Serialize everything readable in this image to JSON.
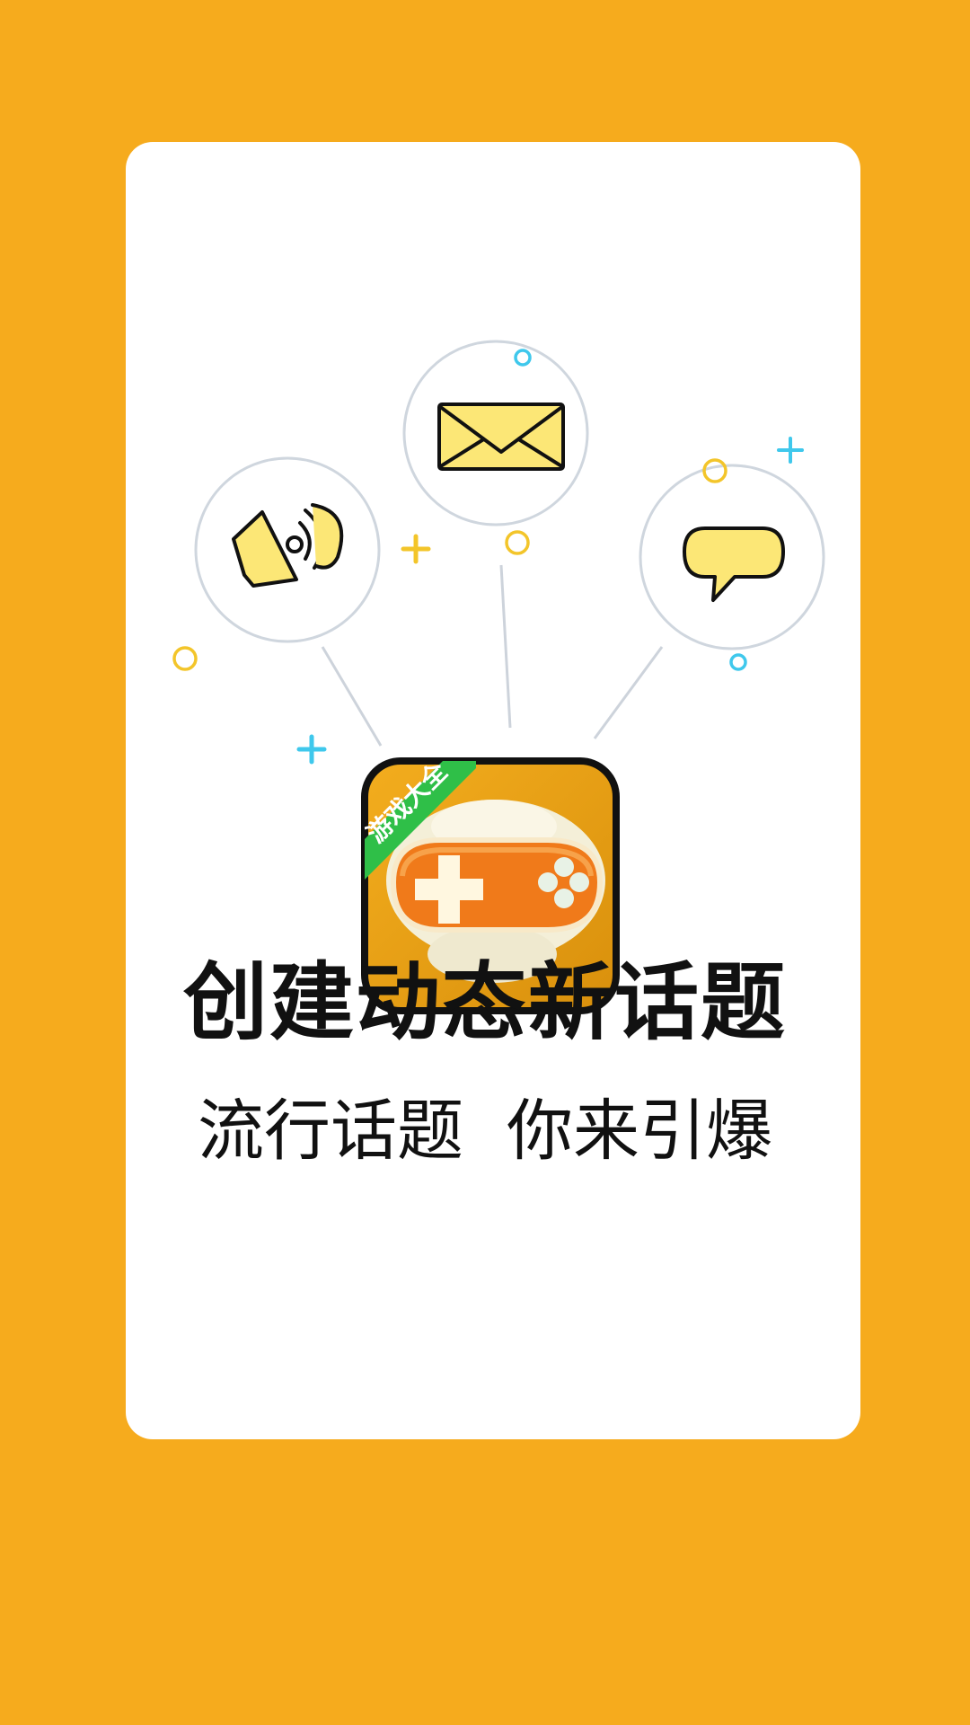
{
  "app": {
    "badge_text": "游戏大全"
  },
  "headline": "创建动态新话题",
  "tagline": {
    "part1": "流行话题",
    "part2": "你来引爆"
  },
  "icons": {
    "left": "speaker-icon",
    "center": "envelope-icon",
    "right": "chat-bubble-icon",
    "app": "gamepad-app-icon"
  },
  "colors": {
    "background": "#F6AB1D",
    "card": "#FFFFFF",
    "icon_fill": "#FCE776",
    "app_icon": "#F0A416",
    "badge": "#2FBF48",
    "accent_cyan": "#3FC8EC",
    "accent_yellow": "#F3C52A"
  }
}
